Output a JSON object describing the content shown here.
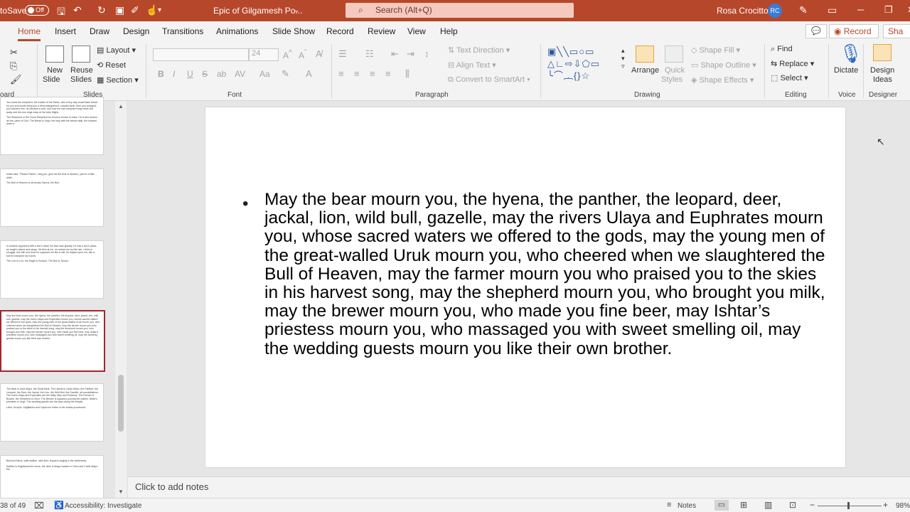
{
  "titlebar": {
    "autosave_label": "toSave",
    "autosave_state": "Off",
    "doc_title": "Epic of Gilgamesh Po...",
    "search_placeholder": "Search (Alt+Q)",
    "user_name": "Rosa Crocitto",
    "user_initials": "RC",
    "minimize": "─",
    "restore": "❐",
    "close": "✕"
  },
  "ribbon_tabs": [
    "Home",
    "Insert",
    "Draw",
    "Design",
    "Transitions",
    "Animations",
    "Slide Show",
    "Record",
    "Review",
    "View",
    "Help"
  ],
  "ribbon_right": {
    "comment": "💬",
    "record": "◉ Record",
    "share": "Sha"
  },
  "ribbon": {
    "clipboard_label": "oard",
    "slides": {
      "new_slide": "New",
      "new_slide2": "Slide",
      "reuse": "Reuse",
      "reuse2": "Slides",
      "layout": "Layout",
      "reset": "Reset",
      "section": "Section",
      "label": "Slides"
    },
    "font": {
      "size": "24",
      "bold": "B",
      "italic": "I",
      "underline": "U",
      "strike": "S",
      "label": "Font"
    },
    "paragraph": {
      "text_direction": "Text Direction",
      "align_text": "Align Text",
      "smartart": "Convert to SmartArt",
      "label": "Paragraph"
    },
    "drawing": {
      "arrange": "Arrange",
      "quick_styles": "Quick",
      "quick_styles2": "Styles",
      "shape_fill": "Shape Fill",
      "shape_outline": "Shape Outline",
      "shape_effects": "Shape Effects",
      "label": "Drawing"
    },
    "editing": {
      "find": "Find",
      "replace": "Replace",
      "select": "Select",
      "label": "Editing"
    },
    "voice": {
      "dictate": "Dictate",
      "label": "Voice"
    },
    "designer": {
      "design_ideas": "Design",
      "design_ideas2": "Ideas",
      "label": "Designer"
    }
  },
  "thumbnails": [
    {
      "lines": [
        "You loved the shepherd, the master of the flocks, who every day would bake bread for you and would bring you a fresh-slaughtered, roasted lamb, then you changed, you touched him, he became a wolf, and now his own shepherd boys drive him away and his own dogs snap at his hairy thighs.",
        "The Shepherd or the Good Shepherd as Jesus is known is Aries. He is also known as the Lamb of God. The Bread is Virgo, the lady with the wheat stalk, the roasted lamb is"
      ]
    },
    {
      "lines": [
        "Ishtar said, \"Please Father, I beg you, give me the Bull of Heaven, just for a little while.",
        "The Bull of Heaven is obviously Taurus, the Bull."
      ]
    },
    {
      "lines": [
        "A creature appeared with a lion's head, his face was ghastly, he had a lion's paws, an eagle's talons and wings. He flew at me, he seized me by the hair, I tried to struggle, but with one blow he capsized me like a raft, he leaped upon me, like a bull he trampled my bones.",
        "The Lion is Leo, the Eagle is Scorpio. The Bull is Taurus."
      ]
    },
    {
      "lines": [
        "May the bear mourn you, the hyena, the panther, the leopard, deer, jackal, lion, wild bull, gazelle, may the rivers Ulaya and Euphrates mourn you, whose sacred waters we offered to the gods, may the young men of the great-walled Uruk mourn you, who cheered when we slaughtered the Bull of Heaven, may the farmer mourn you who praised you to the skies in his harvest song, may the shepherd mourn you, who brought you milk, may the brewer mourn you, who made you fine beer, may Ishtar's priestess mourn you, who massaged you with sweet smelling oil, may the wedding guests mourn you like their own brother."
      ]
    },
    {
      "lines": [
        "The Bear is Ursa Major, the Great Bear. The Hyena is Canis Minor, the Panther, the Leopard, the Deer, the Jackal, the Lion, the Wild Bull, the Gazelle, all constellations. The rivers Ulaya and Euphrates are the Milky Way and Eridanus. The Farmer is Bootes, the Shepherd is Orion. The Brewer is Aquarius pouring the waters. Ishtar's priestess is Virgo. The wedding guests are the stars along the ecliptic.",
        "Libra, Scorpio, Sagittarius and Capricorn follow in the zodiac procession."
      ]
    },
    {
      "lines": [
        "Beloved friend, swift stallion, wild deer, leopard ranging in the wilderness.",
        "Stallion is Sagittarius the horse, the deer is Mriga located in Orion and Canis Major, the"
      ]
    }
  ],
  "slide": {
    "bullet": "•",
    "text": "May the bear mourn you, the hyena, the panther, the leopard, deer, jackal, lion, wild bull, gazelle, may the rivers Ulaya and Euphrates mourn you, whose sacred waters we offered to the gods, may the young men of the great-walled Uruk mourn you, who cheered when we slaughtered the Bull of Heaven, may the farmer mourn you who praised you to the skies in his harvest song, may the shepherd mourn you, who brought you milk, may the brewer mourn you, who made you fine beer, may Ishtar’s priestess mourn you, who massaged you with sweet smelling oil, may the wedding guests mourn you like their own brother."
  },
  "notes_placeholder": "Click to add notes",
  "statusbar": {
    "slide_count": "38 of 49",
    "accessibility": "Accessibility: Investigate",
    "notes": "Notes",
    "zoom": "98%",
    "zoom_minus": "−",
    "zoom_plus": "+"
  }
}
